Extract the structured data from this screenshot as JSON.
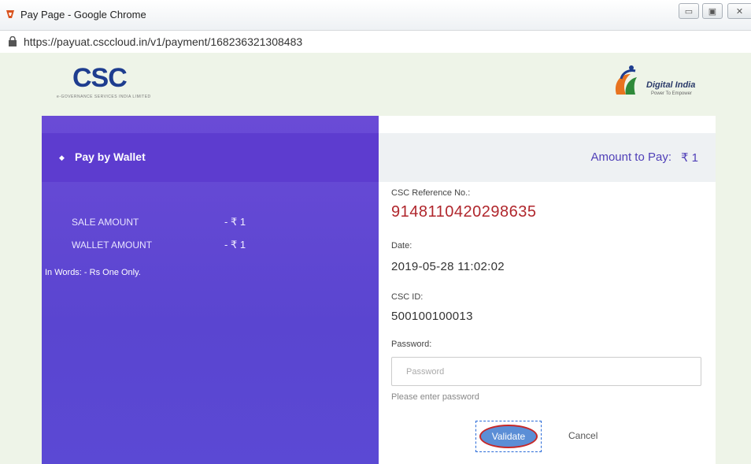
{
  "window": {
    "title": "Pay Page - Google Chrome",
    "url": "https://payuat.csccloud.in/v1/payment/168236321308483"
  },
  "logos": {
    "csc": "CSC",
    "csc_tagline": "e-GOVERNANCE SERVICES INDIA LIMITED",
    "digital_india": "Digital India",
    "digital_india_tagline": "Power To Empower"
  },
  "left": {
    "tab_label": "Pay by Wallet",
    "sale_amount_label": "SALE AMOUNT",
    "sale_amount_value": "- ₹ 1",
    "wallet_amount_label": "WALLET AMOUNT",
    "wallet_amount_value": "- ₹ 1",
    "in_words": "In Words: - Rs One Only."
  },
  "right": {
    "amount_label": "Amount to Pay:",
    "amount_value": "₹ 1",
    "ref_label": "CSC Reference No.:",
    "ref_value": "9148110420298635",
    "date_label": "Date:",
    "date_value": "2019-05-28 11:02:02",
    "cscid_label": "CSC ID:",
    "cscid_value": "500100100013",
    "password_label": "Password:",
    "password_placeholder": "Password",
    "password_value": "",
    "password_hint": "Please enter password",
    "validate_label": "Validate",
    "cancel_label": "Cancel"
  },
  "colors": {
    "panel_purple": "#5b49d4",
    "ref_red": "#b0262c",
    "accent_blue": "#5b8ed6"
  }
}
